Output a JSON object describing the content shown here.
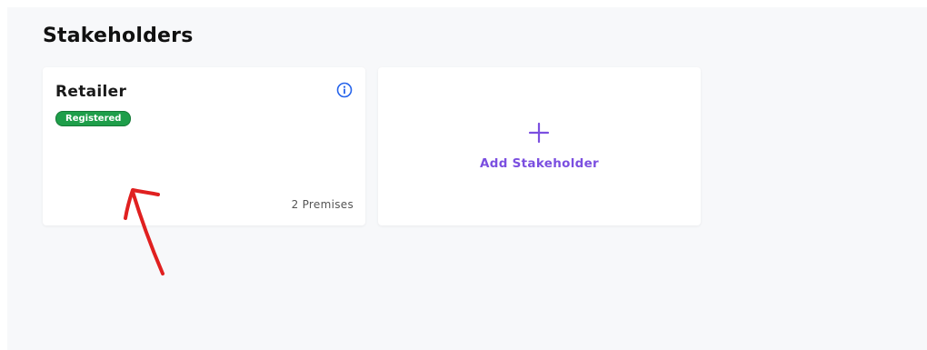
{
  "page": {
    "title": "Stakeholders"
  },
  "cards": [
    {
      "name": "Retailer",
      "status_badge": "Registered",
      "status_color": "#1e9e4a",
      "premises_text": "2 Premises",
      "icon": "info-icon"
    }
  ],
  "add_card": {
    "label": "Add Stakeholder",
    "icon": "plus-icon",
    "accent_color": "#7b4fe0"
  },
  "annotation": {
    "type": "red-arrow",
    "color": "#e02020"
  }
}
